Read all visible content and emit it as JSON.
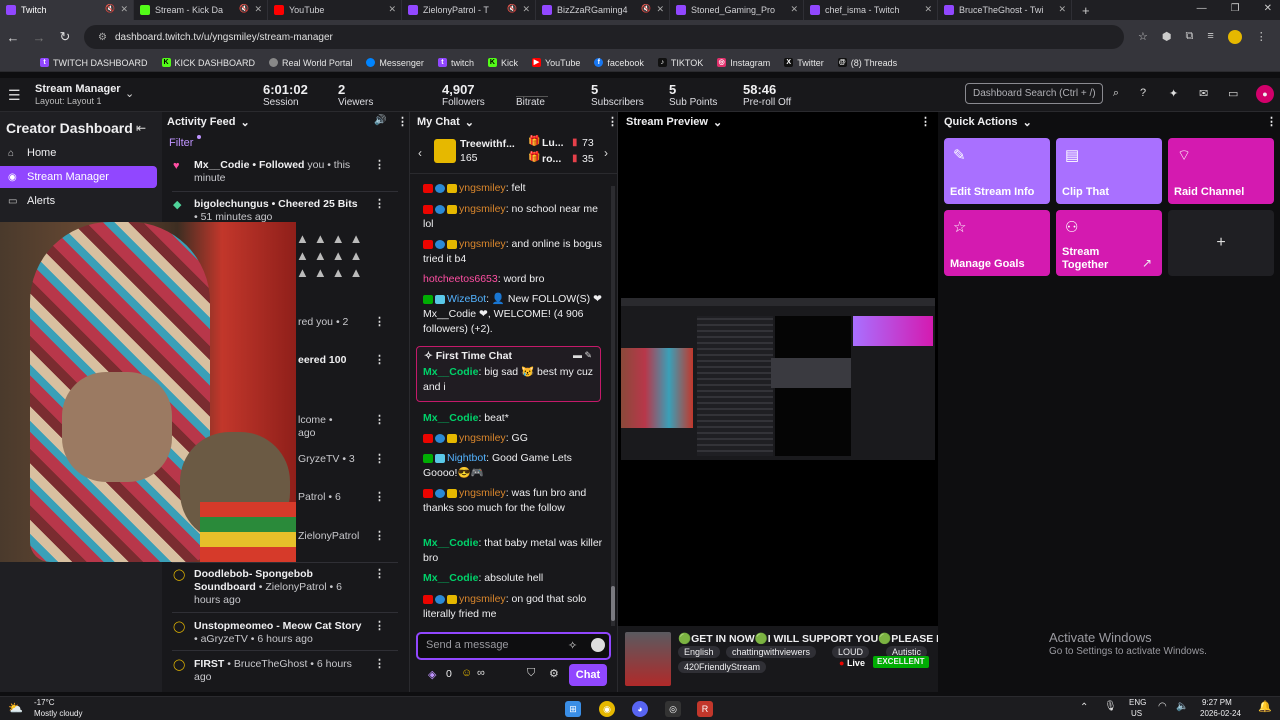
{
  "browser": {
    "tabs": [
      {
        "title": "Twitch",
        "color": "#9147ff",
        "active": true,
        "muted": true
      },
      {
        "title": "Stream - Kick Da",
        "color": "#53fc18",
        "muted": true
      },
      {
        "title": "YouTube",
        "color": "#ff0000"
      },
      {
        "title": "ZielonyPatrol - T",
        "color": "#9147ff",
        "muted": true
      },
      {
        "title": "BizZzaRGaming4",
        "color": "#9147ff",
        "muted": true
      },
      {
        "title": "Stoned_Gaming_Pro",
        "color": "#9147ff"
      },
      {
        "title": "chef_isma - Twitch",
        "color": "#9147ff"
      },
      {
        "title": "BruceTheGhost - Twi",
        "color": "#9147ff"
      }
    ],
    "new_tab": "+",
    "window_controls": [
      "—",
      "❐",
      "✕"
    ],
    "url": "dashboard.twitch.tv/u/yngsmiley/stream-manager",
    "bookmarks": [
      {
        "label": "TWITCH DASHBOARD",
        "color": "#9147ff",
        "glyph": "t"
      },
      {
        "label": "KICK DASHBOARD",
        "color": "#53fc18",
        "glyph": "K"
      },
      {
        "label": "Real World Portal",
        "color": "#888888",
        "glyph": "●"
      },
      {
        "label": "Messenger",
        "color": "#0084ff",
        "glyph": "m"
      },
      {
        "label": "twitch",
        "color": "#9147ff",
        "glyph": "t"
      },
      {
        "label": "Kick",
        "color": "#53fc18",
        "glyph": "K"
      },
      {
        "label": "YouTube",
        "color": "#ff0000",
        "glyph": "▶"
      },
      {
        "label": "facebook",
        "color": "#1877f2",
        "glyph": "f"
      },
      {
        "label": "TIKTOK",
        "color": "#111111",
        "glyph": "♪"
      },
      {
        "label": "Instagram",
        "color": "#e1306c",
        "glyph": "◎"
      },
      {
        "label": "Twitter",
        "color": "#111111",
        "glyph": "X"
      },
      {
        "label": "(8) Threads",
        "color": "#111111",
        "glyph": "@"
      }
    ]
  },
  "header": {
    "title": "Stream Manager",
    "layout": "Layout: Layout 1",
    "stats": [
      {
        "value": "6:01:02",
        "label": "Session"
      },
      {
        "value": "2",
        "label": "Viewers"
      },
      {
        "value": "4,907",
        "label": "Followers"
      },
      {
        "value": "",
        "label": "Bitrate"
      },
      {
        "value": "5",
        "label": "Subscribers"
      },
      {
        "value": "5",
        "label": "Sub Points"
      },
      {
        "value": "58:46",
        "label": "Pre-roll Off"
      }
    ],
    "search_placeholder": "Dashboard Search (Ctrl + /)"
  },
  "left_nav": {
    "title": "Creator Dashboard",
    "items": [
      {
        "label": "Home",
        "icon": "home-icon"
      },
      {
        "label": "Stream Manager",
        "icon": "stream-icon",
        "selected": true
      },
      {
        "label": "Alerts",
        "icon": "alerts-icon"
      }
    ]
  },
  "activity": {
    "title": "Activity Feed",
    "filter": "Filter",
    "items": [
      {
        "user": "Mx__Codie",
        "action": " • Followed",
        "rest": " you • this minute",
        "icon": "heart-icon",
        "color": "#ff4fa3"
      },
      {
        "user": "bigolechungus",
        "action": " • Cheered 25 Bits",
        "rest": " • 51 minutes ago",
        "icon": "bits-icon",
        "color": "#4fd39a"
      },
      {
        "user": "",
        "action": "",
        "rest": "red you • 2",
        "icon": "",
        "color": ""
      },
      {
        "user": "",
        "action": "eered 100",
        "rest": "",
        "icon": "",
        "color": ""
      },
      {
        "user": "",
        "action": "",
        "rest": "lcome • ago",
        "icon": "",
        "color": ""
      },
      {
        "user": "",
        "action": "",
        "rest": "GryzeTV • 3",
        "icon": "",
        "color": ""
      },
      {
        "user": "",
        "action": "",
        "rest": "Patrol • 6",
        "icon": "",
        "color": ""
      },
      {
        "user": "",
        "action": "",
        "rest": "ZielonyPatrol",
        "icon": "",
        "color": ""
      },
      {
        "user": "Doodlebob- Spongebob Soundboard",
        "action": "",
        "rest": " • ZielonyPatrol • 6 hours ago",
        "icon": "redeem-icon",
        "color": "#e6b800"
      },
      {
        "user": "Unstopmeomeo - Meow Cat Story",
        "action": "",
        "rest": " • aGryzeTV • 6 hours ago",
        "icon": "redeem-icon",
        "color": "#e6b800"
      },
      {
        "user": "FIRST",
        "action": "",
        "rest": " • BruceTheGhost • 6 hours ago",
        "icon": "redeem-icon",
        "color": "#e6b800"
      }
    ]
  },
  "chat": {
    "title": "My Chat",
    "top_users": [
      {
        "name": "Treewithf...",
        "value": "165"
      },
      {
        "name": "Lu...",
        "value": "73"
      },
      {
        "name": "ro...",
        "value": "35"
      }
    ],
    "messages": [
      {
        "user": "yngsmiley",
        "text": ": felt",
        "ucolor": "u-orange",
        "badges": [
          "b-red",
          "b-blue",
          "b-gold"
        ]
      },
      {
        "user": "yngsmiley",
        "text": ": no school near me lol",
        "ucolor": "u-orange",
        "badges": [
          "b-red",
          "b-blue",
          "b-gold"
        ]
      },
      {
        "user": "yngsmiley",
        "text": ": and online is bogus tried it b4",
        "ucolor": "u-orange",
        "badges": [
          "b-red",
          "b-blue",
          "b-gold"
        ]
      },
      {
        "user": "hotcheetos6653",
        "text": ": word bro",
        "ucolor": "u-pink",
        "badges": []
      },
      {
        "user": "WizeBot",
        "text": ": 👤 New FOLLOW(S) ❤ Mx__Codie ❤, WELCOME! (4 906 followers) (+2).",
        "ucolor": "u-ltblue",
        "badges": [
          "b-green",
          "b-teal"
        ]
      },
      {
        "user": "Mx__Codie",
        "text": ": beat*",
        "ucolor": "u-green",
        "badges": []
      },
      {
        "user": "yngsmiley",
        "text": ": GG",
        "ucolor": "u-orange",
        "badges": [
          "b-red",
          "b-blue",
          "b-gold"
        ]
      },
      {
        "user": "Nightbot",
        "text": ": Good Game Lets Goooo!😎🎮",
        "ucolor": "u-ltblue",
        "badges": [
          "b-green",
          "b-teal"
        ]
      },
      {
        "user": "yngsmiley",
        "text": ": was fun bro and thanks soo much for the follow",
        "ucolor": "u-orange",
        "badges": [
          "b-red",
          "b-blue",
          "b-gold"
        ]
      },
      {
        "user": "Mx__Codie",
        "text": ": that baby metal was killer bro",
        "ucolor": "u-green",
        "badges": []
      },
      {
        "user": "Mx__Codie",
        "text": ": absolute hell",
        "ucolor": "u-green",
        "badges": []
      },
      {
        "user": "yngsmiley",
        "text": ": on god that solo literally fried me",
        "ucolor": "u-orange",
        "badges": [
          "b-red",
          "b-blue",
          "b-gold"
        ]
      }
    ],
    "first_time": {
      "label": "First Time Chat",
      "user": "Mx__Codie",
      "text": ": big sad 😿 best my cuz and i"
    },
    "input_placeholder": "Send a message",
    "points": "0",
    "button": "Chat"
  },
  "preview": {
    "title": "Stream Preview",
    "ticker": "🟢GET IN NOW🟢I WILL SUPPORT YOU🟢PLEASE I",
    "tags": [
      "English",
      "chattingwithviewers",
      "LOUD",
      "Autistic"
    ],
    "tag2": "420FriendlyStream",
    "live": "Live",
    "quality": "EXCELLENT"
  },
  "quick_actions": {
    "title": "Quick Actions",
    "buttons": [
      {
        "label": "Edit Stream Info",
        "icon": "pencil-icon"
      },
      {
        "label": "Clip That",
        "icon": "clip-icon"
      },
      {
        "label": "Raid Channel",
        "icon": "raid-icon"
      },
      {
        "label": "Manage Goals",
        "icon": "star-icon"
      },
      {
        "label": "Stream Together",
        "icon": "add-user-icon"
      }
    ],
    "add": "+"
  },
  "windows": {
    "activate_title": "Activate Windows",
    "activate_sub": "Go to Settings to activate Windows."
  },
  "taskbar": {
    "temp": "-17°C",
    "weather": "Mostly cloudy",
    "lang": "ENG",
    "region": "US",
    "time": "9:27 PM",
    "date": "2026-02-24"
  }
}
